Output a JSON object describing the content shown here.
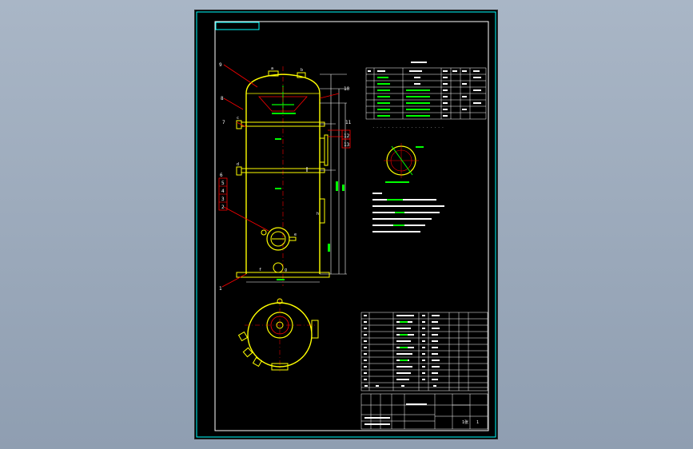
{
  "colors": {
    "background": "#000000",
    "border": "#00ffff",
    "vessel": "#ffff00",
    "leader": "#ff0000",
    "table_lines": "#ffffff",
    "dimension": "#00ff00",
    "text": "#ffffff"
  },
  "callouts": {
    "c1": "1",
    "c2": "2",
    "c3": "3",
    "c4": "4",
    "c5": "5",
    "c6": "6",
    "c7": "7",
    "c8": "8",
    "c9": "9",
    "c10": "10",
    "c11": "11",
    "c12": "12",
    "c13": "13"
  },
  "nozzle_marks": {
    "top_a": "a",
    "top_b": "b",
    "mid_c": "c",
    "side_d": "d",
    "manhole": "e",
    "bottom_f": "f",
    "bottom_g": "g",
    "side_h": "h"
  },
  "title_block": {
    "sheet_label": "1张",
    "sheet_number": "1"
  }
}
